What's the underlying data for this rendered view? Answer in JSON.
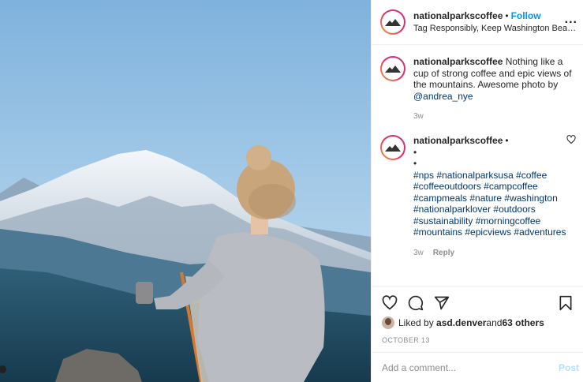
{
  "header": {
    "username": "nationalparkscoffee",
    "dot": "•",
    "follow_label": "Follow",
    "location": "Tag Responsibly, Keep Washington Beaut...",
    "more": "..."
  },
  "caption": {
    "username": "nationalparkscoffee",
    "text": " Nothing like a cup of strong coffee and epic views of the mountains. Awesome photo by ",
    "mention": "@andrea_nye",
    "time": "3w"
  },
  "comment": {
    "username": "nationalparkscoffee",
    "dot": "•",
    "bullet1": "•",
    "bullet2": "•",
    "hashtags": "#nps #nationalparksusa #coffee #coffeeoutdoors #campcoffee #campmeals #nature #washington #nationalparklover #outdoors #sustainability #morningcoffee #mountains #epicviews #adventures",
    "time": "3w",
    "reply_label": "Reply"
  },
  "likes": {
    "prefix": "Liked by ",
    "user": "asd.denver",
    "middle": " and ",
    "count": "63 others"
  },
  "date": "OCTOBER 13",
  "add_comment": {
    "placeholder": "Add a comment...",
    "post_label": "Post"
  },
  "icons": {
    "like": "heart-icon",
    "comment": "comment-icon",
    "share": "share-icon",
    "save": "bookmark-icon",
    "comment_like": "heart-icon"
  },
  "colors": {
    "accent": "#0095f6",
    "link": "#00376b",
    "muted": "#8e8e8e",
    "post_disabled": "#b2dffc"
  }
}
